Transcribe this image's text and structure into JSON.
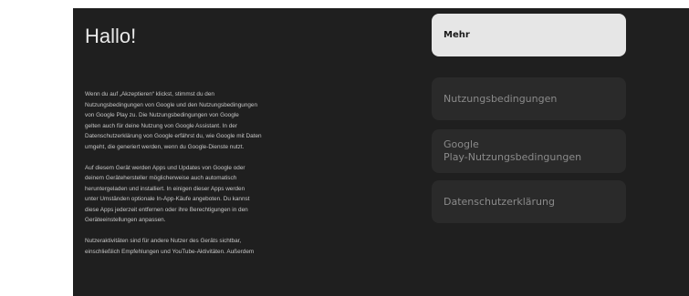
{
  "welcome": {
    "title": "Hallo!"
  },
  "body": {
    "paragraphs": [
      {
        "lines": [
          "Wenn du auf „Akzeptieren“ klickst, stimmst du den",
          "Nutzungsbedingungen von Google und den Nutzungsbedingungen",
          "von Google Play zu. Die Nutzungsbedingungen von Google",
          "gelten auch für deine Nutzung von Google Assistant. In der",
          "Datenschutzerklärung von Google erfährst du, wie Google mit Daten",
          "umgeht, die generiert werden, wenn du Google-Dienste nutzt."
        ]
      },
      {
        "lines": [
          "Auf diesem Gerät werden Apps und Updates von Google oder",
          "deinem Gerätehersteller möglicherweise auch automatisch",
          "heruntergeladen und installiert. In einigen dieser Apps werden",
          "unter Umständen optionale In-App-Käufe angeboten. Du kannst",
          "diese Apps jederzeit entfernen oder ihre Berechtigungen in den",
          "Geräteeinstellungen anpassen."
        ]
      },
      {
        "lines": [
          "Nutzeraktivitäten sind für andere Nutzer des Geräts sichtbar,",
          "einschließlich Empfehlungen und YouTube-Aktivitäten. Außerdem"
        ]
      }
    ]
  },
  "menu": {
    "more_label": "Mehr",
    "terms_label": "Nutzungsbedingungen",
    "play_terms_label_line1": "Google",
    "play_terms_label_line2": "Play-Nutzungsbedingungen",
    "privacy_label": "Datenschutzerklärung",
    "focused_item": "Mehr"
  },
  "colors": {
    "screen_background": "#1f1f1f",
    "button_background": "#2a2a2a",
    "focused_button_background": "#e6e6e6",
    "button_text": "#8a8a8a",
    "focused_button_text": "#1a1a1a"
  }
}
